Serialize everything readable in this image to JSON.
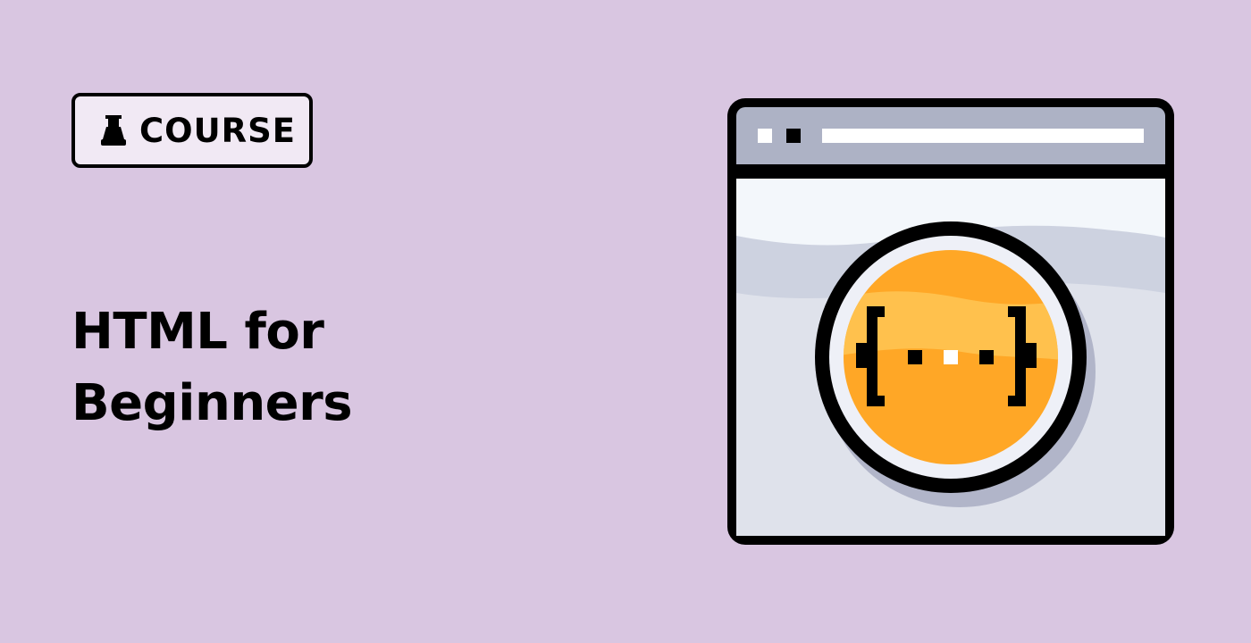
{
  "badge": {
    "label": "COURSE",
    "icon": "pawn-icon"
  },
  "title": {
    "line1": "HTML for",
    "line2": "Beginners"
  },
  "illustration": {
    "icon": "browser-window-code-icon",
    "code_glyph": "{...}"
  },
  "colors": {
    "background": "#d9c6e1",
    "badge_fill": "#f1e9f4",
    "window_bar": "#adb2c5",
    "window_body": "#f3f7fb",
    "wave": "#cdd2e0",
    "circle_orange": "#ffa726",
    "circle_highlight": "#ffc14d",
    "outline": "#000000"
  }
}
